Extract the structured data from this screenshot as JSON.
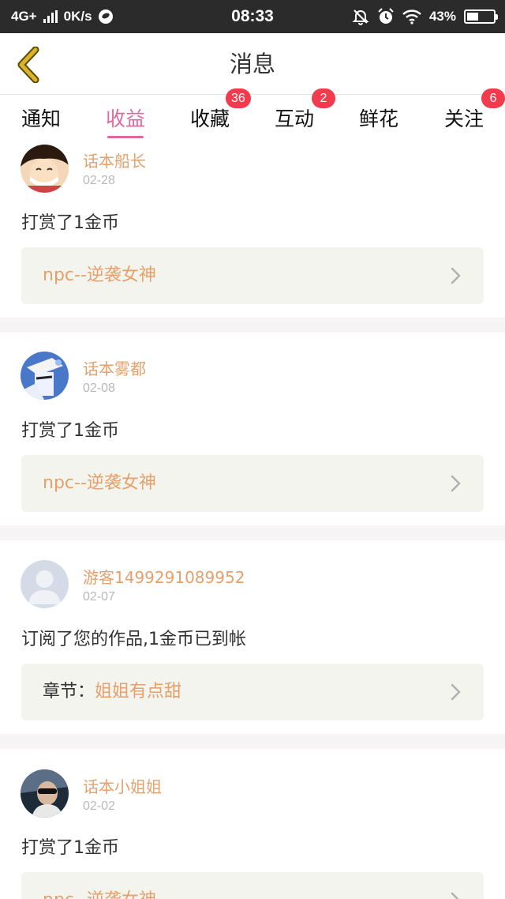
{
  "status_bar": {
    "network": "4G+",
    "speed": "0K/s",
    "time": "08:33",
    "battery": "43%",
    "battery_level": 0.43
  },
  "header": {
    "title": "消息"
  },
  "tabs": [
    {
      "label": "通知",
      "badge": null,
      "active": false
    },
    {
      "label": "收益",
      "badge": null,
      "active": true
    },
    {
      "label": "收藏",
      "badge": "36",
      "active": false
    },
    {
      "label": "互动",
      "badge": "2",
      "active": false
    },
    {
      "label": "鲜花",
      "badge": null,
      "active": false
    },
    {
      "label": "关注",
      "badge": "6",
      "active": false
    }
  ],
  "messages": [
    {
      "user": "话本船长",
      "date": "02-28",
      "content": "打赏了1金币",
      "work_prefix": "",
      "work_title": "npc--逆袭女神",
      "avatar_icon": "avatar-cartoon-icon"
    },
    {
      "user": "话本雾都",
      "date": "02-08",
      "content": "打赏了1金币",
      "work_prefix": "",
      "work_title": "npc--逆袭女神",
      "avatar_icon": "avatar-anime-icon"
    },
    {
      "user": "游客1499291089952",
      "date": "02-07",
      "content": "订阅了您的作品,1金币已到帐",
      "work_prefix": "章节：",
      "work_title": "姐姐有点甜",
      "avatar_icon": "avatar-default-icon"
    },
    {
      "user": "话本小姐姐",
      "date": "02-02",
      "content": "打赏了1金币",
      "work_prefix": "",
      "work_title": "npc--逆袭女神",
      "avatar_icon": "avatar-photo-icon"
    }
  ],
  "colors": {
    "accent": "#e2679f",
    "username": "#e5a06b",
    "badge": "#f23b4d",
    "back_icon": "#c9a21a"
  }
}
